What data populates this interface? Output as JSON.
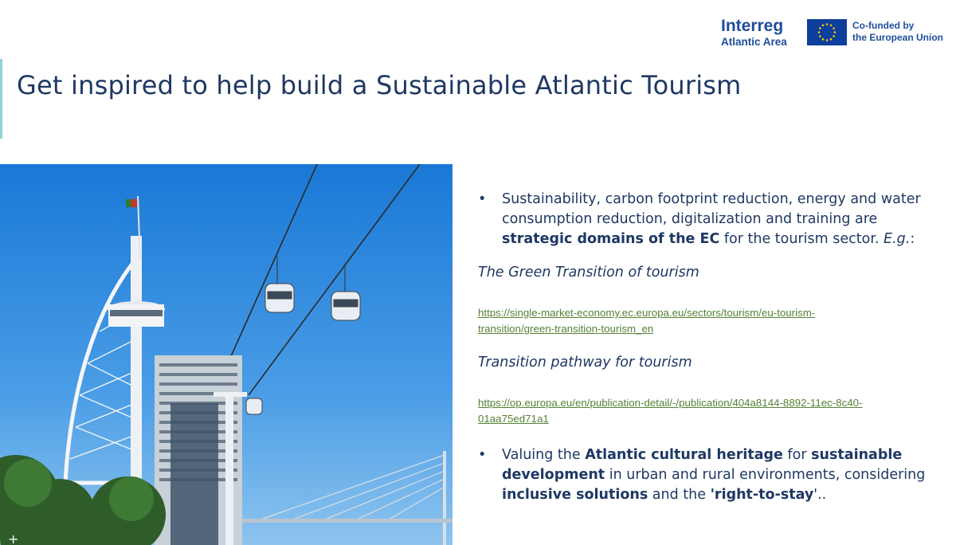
{
  "slide": {
    "title": "Get inspired to help build a Sustainable Atlantic Tourism"
  },
  "logos": {
    "interreg_brand": "Interreg",
    "interreg_area": "Atlantic Area",
    "eu_line1": "Co-funded by",
    "eu_line2": "the European Union"
  },
  "content": {
    "bullet1": {
      "text1": "Sustainability, carbon footprint reduction, energy and water consumption reduction, digitalization and training are ",
      "bold1": "strategic domains of the EC",
      "text2": " for the tourism sector. ",
      "italic1": "E.g.",
      "text3": ":"
    },
    "ref1": {
      "title": "The Green Transition of tourism",
      "link_line1": "https://single-market-economy.ec.europa.eu/sectors/tourism/eu-tourism-",
      "link_line2": "transition/green-transition-tourism_en"
    },
    "ref2": {
      "title": "Transition pathway for tourism",
      "link_line1": "https://op.europa.eu/en/publication-detail/-/publication/404a8144-8892-11ec-8c40-",
      "link_line2": "01aa75ed71a1"
    },
    "bullet2": {
      "text1": "Valuing the ",
      "bold1": "Atlantic cultural heritage",
      "text2": " for ",
      "bold2": "sustainable development",
      "text3": " in urban and rural environments, considering ",
      "bold3": "inclusive solutions",
      "text4": " and the ",
      "bold4": "'right-to-stay",
      "text5": "'.."
    },
    "bullet_glyph": "•"
  },
  "colors": {
    "title": "#1f3864",
    "link": "#548235",
    "eu_blue": "#0f3f9c",
    "eu_star": "#ffcc00",
    "sky_top": "#1a78d6",
    "sky_bottom": "#8ec4ee"
  }
}
